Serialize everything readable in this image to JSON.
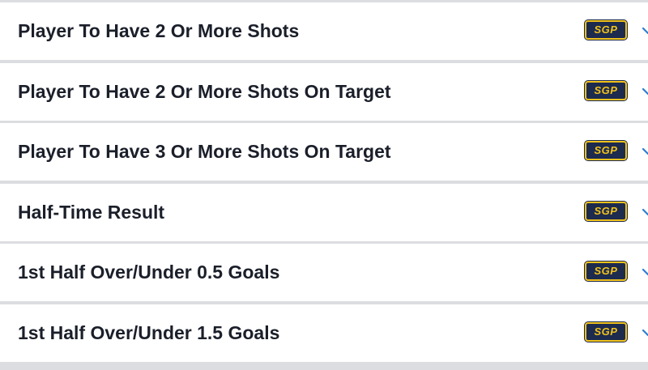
{
  "markets": [
    {
      "label": "Player To Have 2 Or More Shots",
      "badge": "SGP"
    },
    {
      "label": "Player To Have 2 Or More Shots On Target",
      "badge": "SGP"
    },
    {
      "label": "Player To Have 3 Or More Shots On Target",
      "badge": "SGP"
    },
    {
      "label": "Half-Time Result",
      "badge": "SGP"
    },
    {
      "label": "1st Half Over/Under 0.5 Goals",
      "badge": "SGP"
    },
    {
      "label": "1st Half Over/Under 1.5 Goals",
      "badge": "SGP"
    }
  ],
  "colors": {
    "badge_bg": "#1d2b4f",
    "badge_accent": "#f1c21b",
    "chevron": "#2e7dd1"
  },
  "icons": {
    "chevron": "chevron-down-icon"
  }
}
